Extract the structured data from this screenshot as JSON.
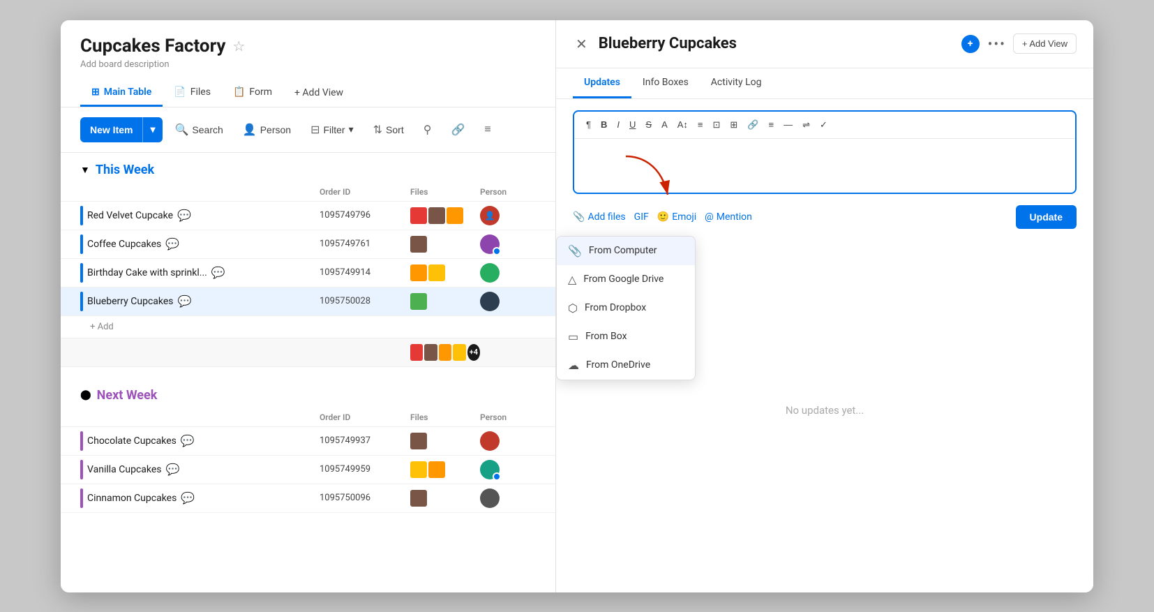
{
  "board": {
    "title": "Cupcakes Factory",
    "description": "Add board description"
  },
  "tabs": [
    {
      "label": "Main Table",
      "icon": "⊞",
      "active": true
    },
    {
      "label": "Files",
      "icon": "📄",
      "active": false
    },
    {
      "label": "Form",
      "icon": "📋",
      "active": false
    }
  ],
  "add_view_label": "+ Add View",
  "toolbar": {
    "new_item_label": "New Item",
    "search_label": "Search",
    "person_label": "Person",
    "filter_label": "Filter",
    "sort_label": "Sort"
  },
  "groups": [
    {
      "id": "this-week",
      "title": "This Week",
      "color": "blue",
      "columns": [
        "Order ID",
        "Files",
        "Person"
      ],
      "items": [
        {
          "name": "Red Velvet Cupcake",
          "order_id": "1095749796",
          "files": [
            "red",
            "brown",
            "orange"
          ],
          "person_color": "person-avatar-1"
        },
        {
          "name": "Coffee Cupcakes",
          "order_id": "1095749761",
          "files": [
            "brown"
          ],
          "person_color": "person-avatar-2"
        },
        {
          "name": "Birthday Cake with sprinkl...",
          "order_id": "1095749914",
          "files": [
            "orange",
            "yellow"
          ],
          "person_color": "person-avatar-3"
        },
        {
          "name": "Blueberry Cupcakes",
          "order_id": "1095750028",
          "files": [
            "green"
          ],
          "person_color": "person-avatar-4",
          "selected": true
        }
      ],
      "summary_files": [
        "red",
        "brown",
        "orange",
        "yellow"
      ],
      "summary_count": "+4"
    },
    {
      "id": "next-week",
      "title": "Next Week",
      "color": "purple",
      "columns": [
        "Order ID",
        "Files",
        "Person"
      ],
      "items": [
        {
          "name": "Chocolate Cupcakes",
          "order_id": "1095749937",
          "files": [
            "brown"
          ],
          "person_color": "person-avatar-5"
        },
        {
          "name": "Vanilla Cupcakes",
          "order_id": "1095749959",
          "files": [
            "yellow",
            "orange"
          ],
          "person_color": "person-avatar-6"
        },
        {
          "name": "Cinnamon Cupcakes",
          "order_id": "1095750096",
          "files": [
            "brown"
          ],
          "person_color": "person-avatar-4"
        }
      ]
    }
  ],
  "add_row_label": "+ Add",
  "detail": {
    "title": "Blueberry Cupcakes",
    "tabs": [
      "Updates",
      "Info Boxes",
      "Activity Log"
    ],
    "active_tab": "Updates",
    "add_view_label": "+ Add View",
    "no_updates_text": "No updates yet...",
    "editor_toolbar_buttons": [
      "¶",
      "B",
      "I",
      "U",
      "S",
      "A",
      "A↕",
      "≡",
      "⊡",
      "⊞",
      "🔗",
      "≡",
      "—",
      "⇌",
      "✓"
    ],
    "actions": {
      "add_files_label": "Add files",
      "gif_label": "GIF",
      "emoji_label": "Emoji",
      "mention_label": "Mention",
      "update_btn_label": "Update"
    },
    "dropdown": {
      "items": [
        {
          "label": "From Computer",
          "icon": "📎"
        },
        {
          "label": "From Google Drive",
          "icon": "△"
        },
        {
          "label": "From Dropbox",
          "icon": "⬡"
        },
        {
          "label": "From Box",
          "icon": "▭"
        },
        {
          "label": "From OneDrive",
          "icon": "☁"
        }
      ]
    }
  }
}
